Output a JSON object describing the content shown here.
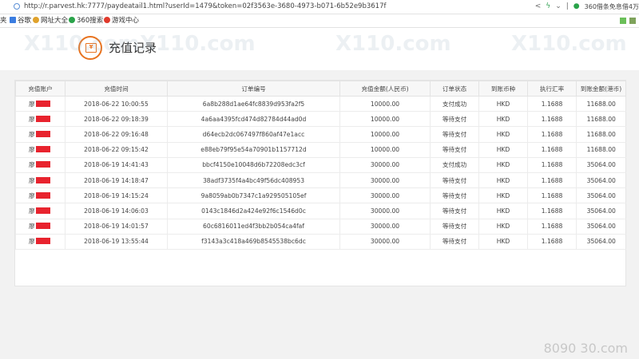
{
  "browser": {
    "url": "http://r.parvest.hk:7777/paydeatail1.html?userId=1479&token=02f3563e-3680-4973-b071-6b52e9b3617f",
    "promo_text": "360借条免息借4万"
  },
  "bookmarks": [
    {
      "label": "夹",
      "icon": "folder-icon"
    },
    {
      "label": "谷歌",
      "icon": "page-icon",
      "color": "#3b7de0"
    },
    {
      "label": "网址大全",
      "icon": "globe-icon",
      "color": "#e0a22c"
    },
    {
      "label": "360搜索",
      "icon": "search-icon",
      "color": "#2aa34a"
    },
    {
      "label": "游戏中心",
      "icon": "game-icon",
      "color": "#e03a2c"
    }
  ],
  "page": {
    "title": "充值记录",
    "logo_glyph": "¥"
  },
  "table": {
    "headers": [
      "充值账户",
      "充值时间",
      "订单编号",
      "充值金额(人民币)",
      "订单状态",
      "到账币种",
      "执行汇率",
      "到账金额(港币)"
    ],
    "rows": [
      {
        "account": "廖",
        "time": "2018-06-22 10:00:55",
        "order": "6a8b288d1ae64fc8839d953fa2f5",
        "amount": "10000.00",
        "status": "支付成功",
        "currency": "HKD",
        "rate": "1.1688",
        "credited": "11688.00"
      },
      {
        "account": "廖",
        "time": "2018-06-22 09:18:39",
        "order": "4a6aa4395fcd474d82784d44ad0d",
        "amount": "10000.00",
        "status": "等待支付",
        "currency": "HKD",
        "rate": "1.1688",
        "credited": "11688.00"
      },
      {
        "account": "廖",
        "time": "2018-06-22 09:16:48",
        "order": "d64ecb2dc067497f860af47e1acc",
        "amount": "10000.00",
        "status": "等待支付",
        "currency": "HKD",
        "rate": "1.1688",
        "credited": "11688.00"
      },
      {
        "account": "廖",
        "time": "2018-06-22 09:15:42",
        "order": "e88eb79f95e54a70901b1157712d",
        "amount": "10000.00",
        "status": "等待支付",
        "currency": "HKD",
        "rate": "1.1688",
        "credited": "11688.00"
      },
      {
        "account": "廖",
        "time": "2018-06-19 14:41:43",
        "order": "bbcf4150e10048d6b72208edc3cf",
        "amount": "30000.00",
        "status": "支付成功",
        "currency": "HKD",
        "rate": "1.1688",
        "credited": "35064.00"
      },
      {
        "account": "廖",
        "time": "2018-06-19 14:18:47",
        "order": "38adf3735f4a4bc49f56dc408953",
        "amount": "30000.00",
        "status": "等待支付",
        "currency": "HKD",
        "rate": "1.1688",
        "credited": "35064.00"
      },
      {
        "account": "廖",
        "time": "2018-06-19 14:15:24",
        "order": "9a8059ab0b7347c1a929505105ef",
        "amount": "30000.00",
        "status": "等待支付",
        "currency": "HKD",
        "rate": "1.1688",
        "credited": "35064.00"
      },
      {
        "account": "廖",
        "time": "2018-06-19 14:06:03",
        "order": "0143c1846d2a424e92f6c1546d0c",
        "amount": "30000.00",
        "status": "等待支付",
        "currency": "HKD",
        "rate": "1.1688",
        "credited": "35064.00"
      },
      {
        "account": "廖",
        "time": "2018-06-19 14:01:57",
        "order": "60c6816011ed4f3bb2b054ca4faf",
        "amount": "30000.00",
        "status": "等待支付",
        "currency": "HKD",
        "rate": "1.1688",
        "credited": "35064.00"
      },
      {
        "account": "廖",
        "time": "2018-06-19 13:55:44",
        "order": "f3143a3c418a469b8545538bc6dc",
        "amount": "30000.00",
        "status": "等待支付",
        "currency": "HKD",
        "rate": "1.1688",
        "credited": "35064.00"
      }
    ]
  },
  "watermark": {
    "text": "X110.com",
    "corner": "8090 30.com"
  },
  "colors": {
    "accent": "#e8731f",
    "redaction": "#e8232e"
  }
}
